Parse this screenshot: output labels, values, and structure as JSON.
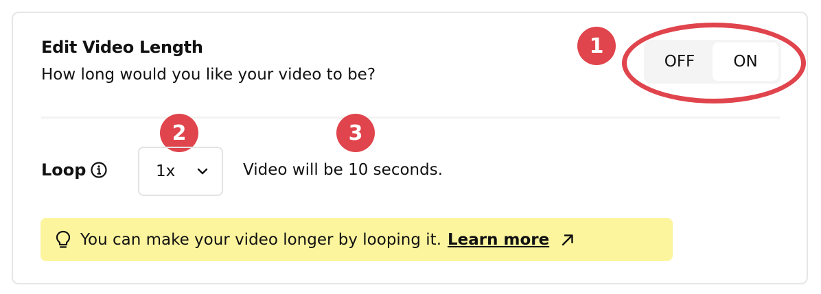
{
  "section": {
    "title": "Edit Video Length",
    "subtitle": "How long would you like your video to be?"
  },
  "toggle": {
    "off_label": "OFF",
    "on_label": "ON",
    "selected": "ON"
  },
  "loop": {
    "label": "Loop",
    "select_value": "1x",
    "duration_text": "Video will be 10 seconds."
  },
  "tip": {
    "text": "You can make your video longer by looping it.",
    "link_label": "Learn more"
  },
  "annotations": {
    "badge_1": "1",
    "badge_2": "2",
    "badge_3": "3",
    "color": "#e0444c"
  },
  "icons": [
    "info-icon",
    "chevron-down-icon",
    "lightbulb-icon",
    "arrow-up-right-icon"
  ]
}
